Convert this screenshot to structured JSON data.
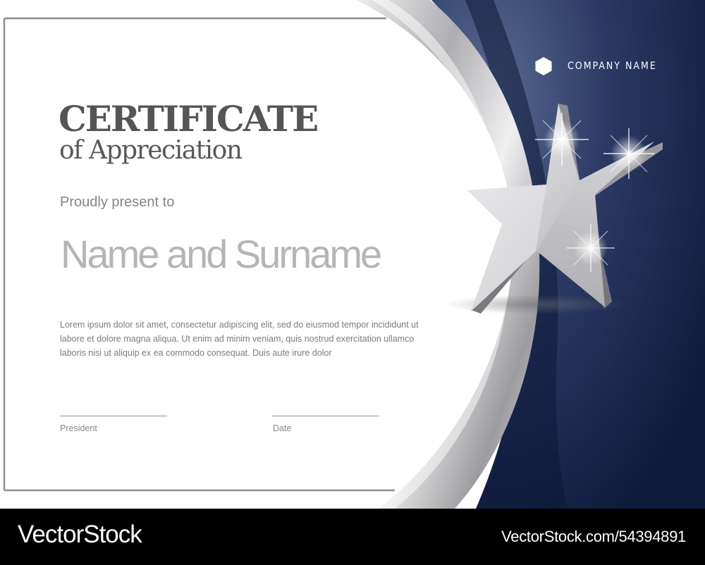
{
  "company": {
    "name": "COMPANY NAME",
    "logo_icon": "hexagon-icon"
  },
  "certificate": {
    "title": "CERTIFICATE",
    "subtitle": "of Appreciation",
    "presented_text": "Proudly present to",
    "recipient": "Name and Surname",
    "body_lines": [
      "Lorem ipsum dolor sit amet, consectetur adipiscing elit, sed do eiusmod tempor incididunt ut",
      "labore et dolore magna aliqua. Ut enim ad minim veniam, quis nostrud exercitation ullamco",
      "laboris nisi ut aliquip ex ea commodo consequat. Duis aute irure dolor"
    ],
    "signatures": {
      "left_label": "President",
      "right_label": "Date"
    }
  },
  "watermark": {
    "logo_text": "VectorStock",
    "url_text": "VectorStock.com/54394891"
  },
  "colors": {
    "navy": "#14224b",
    "navy_light": "#3d4f78",
    "silver": "#c8c8cb",
    "text_gray": "#555558",
    "footer": "#000000"
  },
  "decoration": {
    "star_icon": "star-icon",
    "sparkle_icon": "sparkle-icon"
  }
}
